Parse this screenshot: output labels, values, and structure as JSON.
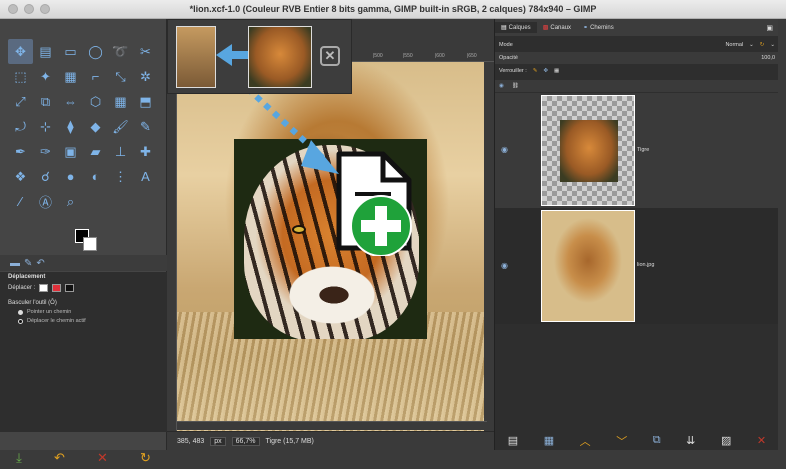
{
  "window": {
    "title": "*lion.xcf-1.0 (Couleur RVB Entier 8 bits gamma, GIMP built-in sRGB, 2 calques) 784x940 – GIMP"
  },
  "toolbox": {
    "tools": [
      {
        "name": "move-tool-icon",
        "glyph": "✥",
        "active": true
      },
      {
        "name": "align-tool-icon",
        "glyph": "▤"
      },
      {
        "name": "rect-select-icon",
        "glyph": "▭"
      },
      {
        "name": "ellipse-select-icon",
        "glyph": "◯"
      },
      {
        "name": "lasso-icon",
        "glyph": "➰"
      },
      {
        "name": "scissors-icon",
        "glyph": "✂"
      },
      {
        "name": "fuzzy-select-icon",
        "glyph": "⬚"
      },
      {
        "name": "magic-wand-icon",
        "glyph": "✦"
      },
      {
        "name": "color-select-icon",
        "glyph": "▦"
      },
      {
        "name": "crop-icon",
        "glyph": "⌐"
      },
      {
        "name": "unified-transform-icon",
        "glyph": "⤡"
      },
      {
        "name": "warp-icon",
        "glyph": "✲"
      },
      {
        "name": "scale-icon",
        "glyph": "⤢"
      },
      {
        "name": "shear-icon",
        "glyph": "⧉"
      },
      {
        "name": "flip-icon",
        "glyph": "⇔"
      },
      {
        "name": "cage-icon",
        "glyph": "⬡"
      },
      {
        "name": "grid-icon",
        "glyph": "▦"
      },
      {
        "name": "perspective-icon",
        "glyph": "⬒"
      },
      {
        "name": "transform-icon",
        "glyph": "⤾"
      },
      {
        "name": "handle-transform-icon",
        "glyph": "⊹"
      },
      {
        "name": "clone-icon",
        "glyph": "⧫"
      },
      {
        "name": "diamond-icon",
        "glyph": "◆"
      },
      {
        "name": "paintbrush-icon",
        "glyph": "🖌"
      },
      {
        "name": "pencil-icon",
        "glyph": "✎"
      },
      {
        "name": "airbrush-icon",
        "glyph": "✒"
      },
      {
        "name": "ink-icon",
        "glyph": "✑"
      },
      {
        "name": "image-icon",
        "glyph": "▣"
      },
      {
        "name": "eraser-icon",
        "glyph": "▰"
      },
      {
        "name": "stamp-icon",
        "glyph": "⊥"
      },
      {
        "name": "heal-icon",
        "glyph": "✚"
      },
      {
        "name": "blend-icon",
        "glyph": "❖"
      },
      {
        "name": "smudge-icon",
        "glyph": "☌"
      },
      {
        "name": "dodge-icon",
        "glyph": "●"
      },
      {
        "name": "burn-icon",
        "glyph": "◐"
      },
      {
        "name": "measure-icon",
        "glyph": "⋮"
      },
      {
        "name": "text-icon",
        "glyph": "A"
      },
      {
        "name": "path-icon",
        "glyph": "⁄"
      },
      {
        "name": "gegl-icon",
        "glyph": "Ⓐ"
      },
      {
        "name": "zoom-icon",
        "glyph": "⌕"
      }
    ],
    "options_tabs": [
      {
        "name": "tool-options-tab-icon",
        "glyph": "▬"
      },
      {
        "name": "brush-tab-icon",
        "glyph": "✎"
      },
      {
        "name": "undo-tab-icon",
        "glyph": "↶"
      }
    ],
    "options": {
      "title": "Déplacement",
      "move_label": "Déplacer :",
      "toggle_label": "Basculer l'outil (Ô)",
      "radio1": "Pointer un chemin",
      "radio2": "Déplacer le chemin actif"
    },
    "bottom": [
      {
        "name": "save-options-icon",
        "glyph": "⤓",
        "color": "#6ab04c"
      },
      {
        "name": "restore-icon",
        "glyph": "↶",
        "color": "#e0a020"
      },
      {
        "name": "delete-icon",
        "glyph": "✕",
        "color": "#c0392b"
      },
      {
        "name": "reset-icon",
        "glyph": "↻",
        "color": "#e0a020"
      }
    ]
  },
  "canvas": {
    "rulers": [
      "|500",
      "|550",
      "|600",
      "|650",
      "|700"
    ],
    "status": {
      "coords": "385, 483",
      "unit": "px",
      "zoom": "66,7%",
      "layer_info": "Tigre (15,7 MB)"
    }
  },
  "layers_panel": {
    "tabs": [
      {
        "label": "Calques"
      },
      {
        "label": "Canaux"
      },
      {
        "label": "Chemins"
      }
    ],
    "mode_label": "Mode",
    "mode_value": "Normal",
    "opacity_label": "Opacité",
    "opacity_value": "100,0",
    "lock_label": "Verrouiller :",
    "layers": [
      {
        "name": "Tigre",
        "selected": true
      },
      {
        "name": "lion.jpg",
        "selected": false
      }
    ],
    "bottom": [
      {
        "name": "new-layer-icon",
        "glyph": "▤",
        "color": "#ddd"
      },
      {
        "name": "new-group-icon",
        "glyph": "▦",
        "color": "#8cb0d8"
      },
      {
        "name": "raise-layer-icon",
        "glyph": "︿",
        "color": "#e0a020"
      },
      {
        "name": "lower-layer-icon",
        "glyph": "﹀",
        "color": "#e0a020"
      },
      {
        "name": "duplicate-layer-icon",
        "glyph": "⧉",
        "color": "#8cb0d8"
      },
      {
        "name": "merge-layer-icon",
        "glyph": "⇊",
        "color": "#ddd"
      },
      {
        "name": "mask-icon",
        "glyph": "▨",
        "color": "#ddd"
      },
      {
        "name": "delete-layer-icon",
        "glyph": "✕",
        "color": "#c0392b"
      }
    ]
  }
}
